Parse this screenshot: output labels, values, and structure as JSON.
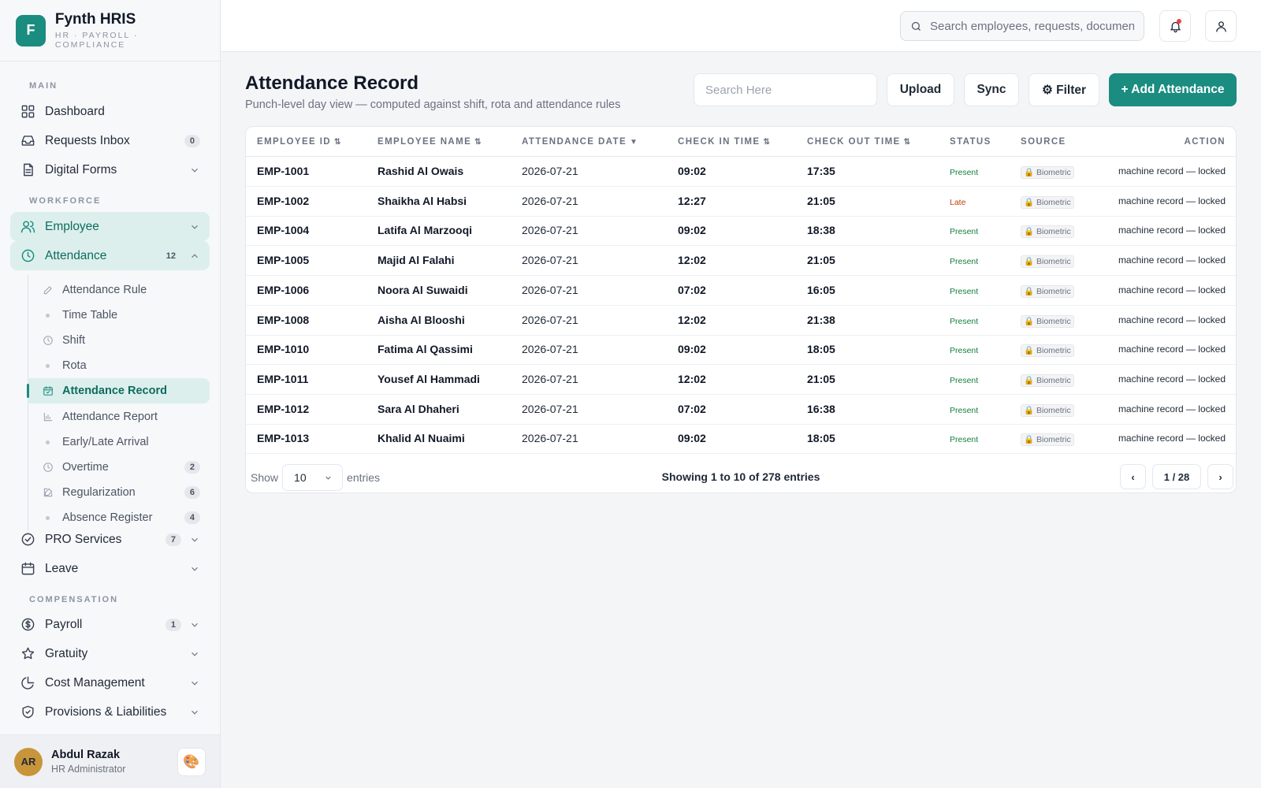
{
  "brand": {
    "logo_letter": "F",
    "name": "Fynth HRIS",
    "tagline": "HR · PAYROLL · COMPLIANCE"
  },
  "sidebar": {
    "sections": {
      "main": "MAIN",
      "workforce": "WORKFORCE",
      "compensation": "COMPENSATION"
    },
    "items": {
      "dashboard": {
        "label": "Dashboard",
        "icon": "grid-icon"
      },
      "requests_inbox": {
        "label": "Requests Inbox",
        "badge": "0",
        "icon": "inbox-icon"
      },
      "digital_forms": {
        "label": "Digital Forms",
        "icon": "document-icon"
      },
      "employee": {
        "label": "Employee",
        "icon": "users-icon"
      },
      "attendance": {
        "label": "Attendance",
        "badge": "12",
        "icon": "clock-icon"
      },
      "pro_services": {
        "label": "PRO Services",
        "badge": "7",
        "icon": "check-circle-icon"
      },
      "leave": {
        "label": "Leave",
        "icon": "calendar-icon"
      },
      "payroll": {
        "label": "Payroll",
        "badge": "1",
        "icon": "dollar-icon"
      },
      "gratuity": {
        "label": "Gratuity",
        "icon": "star-icon"
      },
      "cost_management": {
        "label": "Cost Management",
        "icon": "pie-chart-icon"
      },
      "provisions": {
        "label": "Provisions & Liabilities",
        "icon": "shield-icon"
      }
    },
    "attendance_sub": {
      "attendance_rule": {
        "label": "Attendance Rule"
      },
      "time_table": {
        "label": "Time Table"
      },
      "shift": {
        "label": "Shift"
      },
      "rota": {
        "label": "Rota"
      },
      "attendance_record": {
        "label": "Attendance Record"
      },
      "attendance_report": {
        "label": "Attendance Report"
      },
      "early_late_arrival": {
        "label": "Early/Late Arrival"
      },
      "overtime": {
        "label": "Overtime",
        "badge": "2"
      },
      "regularization": {
        "label": "Regularization",
        "badge": "6"
      },
      "absence_register": {
        "label": "Absence Register",
        "badge": "4"
      }
    }
  },
  "user": {
    "initials": "AR",
    "name": "Abdul Razak",
    "role": "HR Administrator",
    "theme_icon": "🎨"
  },
  "topbar": {
    "search_placeholder": "Search employees, requests, documents"
  },
  "page": {
    "title": "Attendance Record",
    "subtitle": "Punch-level day view — computed against shift, rota and attendance rules",
    "search_placeholder": "Search Here",
    "upload_label": "Upload",
    "sync_label": "Sync",
    "filter_label": "⚙ Filter",
    "add_label": "+ Add Attendance"
  },
  "table": {
    "columns": {
      "employee_id": "EMPLOYEE ID",
      "employee_name": "EMPLOYEE NAME",
      "attendance_date": "ATTENDANCE DATE",
      "check_in": "CHECK IN TIME",
      "check_out": "CHECK OUT TIME",
      "status": "STATUS",
      "source": "SOURCE",
      "action": "ACTION"
    },
    "sort_glyph": "⇅",
    "sort_active_glyph": "▼",
    "rows": [
      {
        "id": "EMP-1001",
        "name": "Rashid Al Owais",
        "date": "2026-07-21",
        "in": "09:02",
        "out": "17:35",
        "status": "Present",
        "source": "🔒 Biometric",
        "action": "machine record — locked"
      },
      {
        "id": "EMP-1002",
        "name": "Shaikha Al Habsi",
        "date": "2026-07-21",
        "in": "12:27",
        "out": "21:05",
        "status": "Late",
        "source": "🔒 Biometric",
        "action": "machine record — locked"
      },
      {
        "id": "EMP-1004",
        "name": "Latifa Al Marzooqi",
        "date": "2026-07-21",
        "in": "09:02",
        "out": "18:38",
        "status": "Present",
        "source": "🔒 Biometric",
        "action": "machine record — locked"
      },
      {
        "id": "EMP-1005",
        "name": "Majid Al Falahi",
        "date": "2026-07-21",
        "in": "12:02",
        "out": "21:05",
        "status": "Present",
        "source": "🔒 Biometric",
        "action": "machine record — locked"
      },
      {
        "id": "EMP-1006",
        "name": "Noora Al Suwaidi",
        "date": "2026-07-21",
        "in": "07:02",
        "out": "16:05",
        "status": "Present",
        "source": "🔒 Biometric",
        "action": "machine record — locked"
      },
      {
        "id": "EMP-1008",
        "name": "Aisha Al Blooshi",
        "date": "2026-07-21",
        "in": "12:02",
        "out": "21:38",
        "status": "Present",
        "source": "🔒 Biometric",
        "action": "machine record — locked"
      },
      {
        "id": "EMP-1010",
        "name": "Fatima Al Qassimi",
        "date": "2026-07-21",
        "in": "09:02",
        "out": "18:05",
        "status": "Present",
        "source": "🔒 Biometric",
        "action": "machine record — locked"
      },
      {
        "id": "EMP-1011",
        "name": "Yousef Al Hammadi",
        "date": "2026-07-21",
        "in": "12:02",
        "out": "21:05",
        "status": "Present",
        "source": "🔒 Biometric",
        "action": "machine record — locked"
      },
      {
        "id": "EMP-1012",
        "name": "Sara Al Dhaheri",
        "date": "2026-07-21",
        "in": "07:02",
        "out": "16:38",
        "status": "Present",
        "source": "🔒 Biometric",
        "action": "machine record — locked"
      },
      {
        "id": "EMP-1013",
        "name": "Khalid Al Nuaimi",
        "date": "2026-07-21",
        "in": "09:02",
        "out": "18:05",
        "status": "Present",
        "source": "🔒 Biometric",
        "action": "machine record — locked"
      }
    ]
  },
  "footer": {
    "show_label": "Show",
    "page_size": "10",
    "entries_label": "entries",
    "info": "Showing 1 to 10 of 278 entries",
    "prev": "‹",
    "page_indicator": "1 / 28",
    "next": "›"
  },
  "colors": {
    "accent": "#1a8c80",
    "accent_light": "#dcefec",
    "present": "#15803d",
    "late": "#c2410c"
  }
}
